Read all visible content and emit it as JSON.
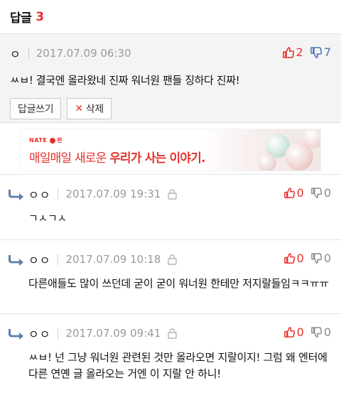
{
  "header": {
    "title": "답글",
    "count": "3"
  },
  "main_comment": {
    "nick": "ㅇ",
    "date": "2017.07.09 06:30",
    "up": "2",
    "down": "7",
    "body": "ㅆㅂ! 결국엔 올라왔네 진짜 워너원 팬들 징하다 진짜!",
    "reply_button": "답글쓰기",
    "delete_button": "삭제"
  },
  "ad": {
    "brand": "NATE",
    "brand_suffix": "판",
    "text_normal": "매일매일 새로운 ",
    "text_strong": "우리가 사는 이야기."
  },
  "replies": [
    {
      "nick": "ㅇㅇ",
      "date": "2017.07.09 19:31",
      "up": "0",
      "down": "0",
      "body": "ㄱㅅㄱㅅ"
    },
    {
      "nick": "ㅇㅇ",
      "date": "2017.07.09 10:18",
      "up": "0",
      "down": "0",
      "body": "다른애들도 많이 쓰던데 굳이 굳이 워너원 한테만 저지랄들임ㅋㅋㅠㅠ"
    },
    {
      "nick": "ㅇㅇ",
      "date": "2017.07.09 09:41",
      "up": "0",
      "down": "0",
      "body": "ㅆㅂ! 넌 그냥 워너원 관련된 것만 올라오면 지랄이지! 그럼 왜 엔터에 다른 연옌 글 올라오는 거엔 이 지랄 안 하니!"
    }
  ],
  "icons": {
    "thumbs_up": "thumbs-up-icon",
    "thumbs_down": "thumbs-down-icon",
    "reply_arrow": "reply-arrow-icon",
    "lock": "lock-icon",
    "close": "close-icon"
  },
  "colors": {
    "accent_red": "#e8302c",
    "down_blue": "#4a74b6",
    "main_bg": "#f4f4f4"
  }
}
